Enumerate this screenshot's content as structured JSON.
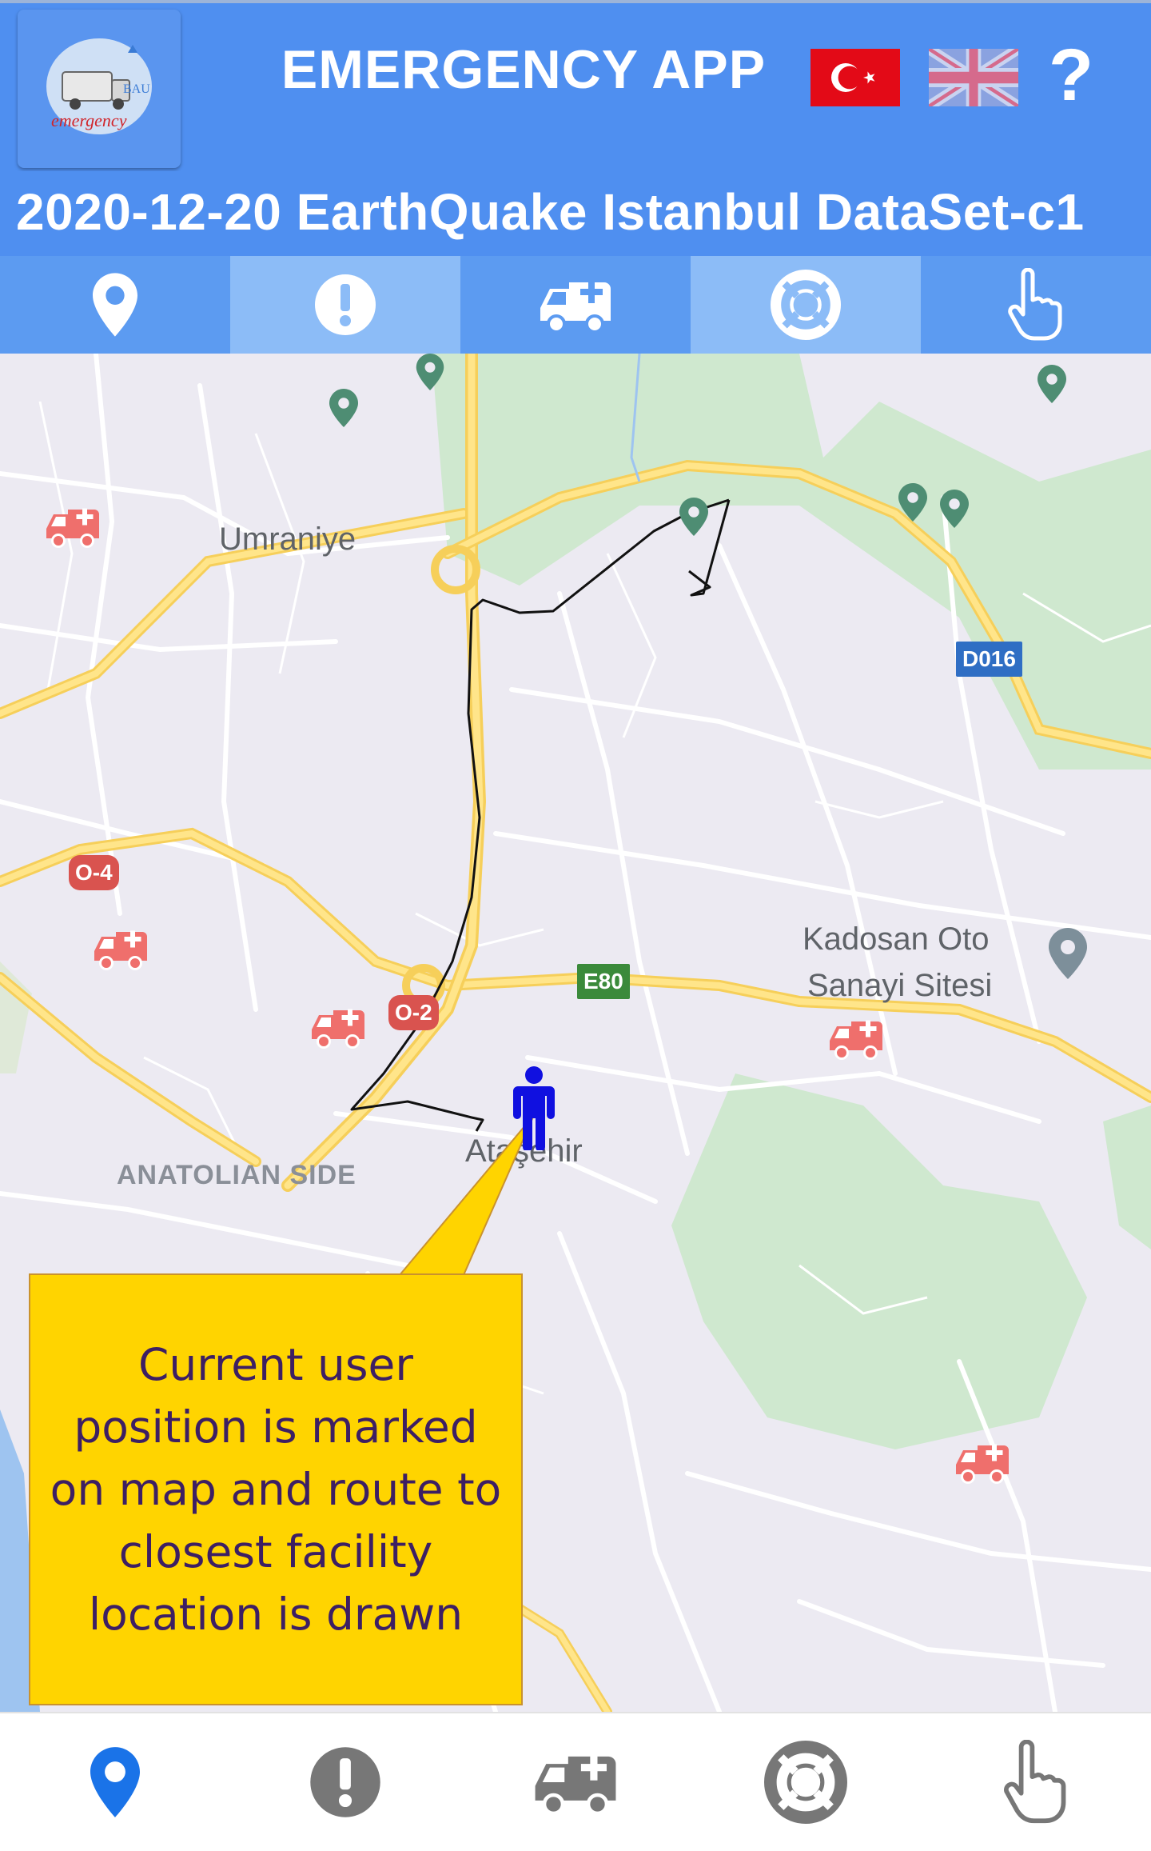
{
  "header": {
    "title": "EMERGENCY APP",
    "logo_icon": "emergency-logo-icon",
    "logo_text": "emergency",
    "logo_mark": "BAU",
    "flags": [
      "turkish-flag-icon",
      "uk-flag-icon"
    ],
    "help_label": "?"
  },
  "dataset": {
    "title": "2020-12-20 EarthQuake Istanbul DataSet-c1"
  },
  "tabs": [
    {
      "icon": "map-pin-icon",
      "active": false
    },
    {
      "icon": "exclamation-icon",
      "active": true
    },
    {
      "icon": "ambulance-icon",
      "active": false
    },
    {
      "icon": "lifebuoy-icon",
      "active": true
    },
    {
      "icon": "pointing-hand-icon",
      "active": false
    }
  ],
  "map": {
    "places": {
      "umraniye": "Umraniye",
      "kadosan_1": "Kadosan Oto",
      "kadosan_2": "Sanayi Sitesi",
      "atasehir": "Ataşehir",
      "anatolian": "ANATOLIAN SIDE"
    },
    "roads": {
      "d016": "D016",
      "o4": "O-4",
      "e80": "E80",
      "o2": "O-2"
    },
    "user_marker": "person-icon",
    "callout": "Current user position is marked on map and route to closest facility location is drawn"
  },
  "bottom_nav": [
    {
      "icon": "map-pin-icon",
      "active": true
    },
    {
      "icon": "exclamation-icon",
      "active": false
    },
    {
      "icon": "ambulance-icon",
      "active": false
    },
    {
      "icon": "lifebuoy-icon",
      "active": false
    },
    {
      "icon": "pointing-hand-icon",
      "active": false
    }
  ],
  "colors": {
    "header": "#4f8ff0",
    "tab_light": "#8cbcf7",
    "callout": "#ffd400",
    "active_nav": "#1a73e8",
    "inactive_nav": "#777777"
  }
}
